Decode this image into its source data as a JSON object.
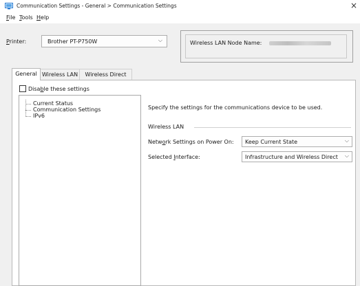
{
  "window": {
    "title": "Communication Settings - General > Communication Settings",
    "close_glyph": "×"
  },
  "menu": [
    {
      "label": "File",
      "mnemonic": "F"
    },
    {
      "label": "Tools",
      "mnemonic": "T"
    },
    {
      "label": "Help",
      "mnemonic": "H"
    }
  ],
  "printer": {
    "label": "Printer:",
    "selected": "Brother PT-P750W",
    "chevron": "⌵"
  },
  "node_info": {
    "label": "Wireless LAN Node Name:"
  },
  "tabs": [
    {
      "label": "General",
      "active": true
    },
    {
      "label": "Wireless LAN",
      "active": false
    },
    {
      "label": "Wireless Direct",
      "active": false
    }
  ],
  "disable_settings": {
    "label": "Disable these settings",
    "checked": false
  },
  "tree": [
    {
      "label": "Current Status"
    },
    {
      "label": "Communication Settings"
    },
    {
      "label": "IPv6"
    }
  ],
  "content": {
    "description": "Specify the settings for the communications device to be used.",
    "section_heading": "Wireless LAN",
    "network_on_power": {
      "label": "Network Settings on Power On:",
      "value": "Keep Current State"
    },
    "selected_interface": {
      "label": "Selected Interface:",
      "value": "Infrastructure and Wireless Direct"
    }
  }
}
